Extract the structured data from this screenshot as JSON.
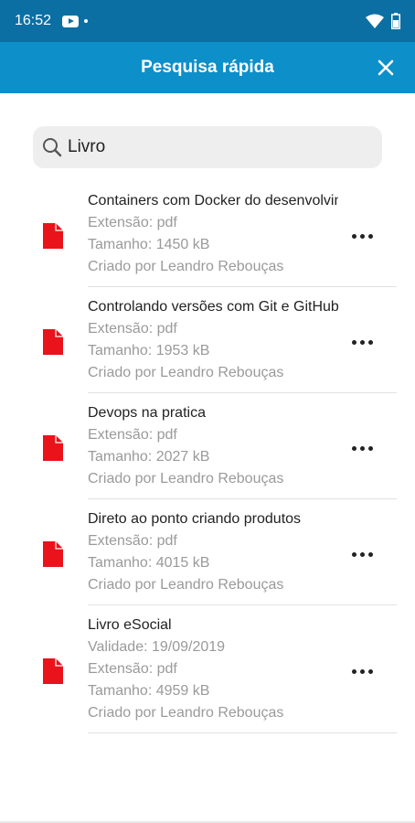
{
  "status_bar": {
    "time": "16:52"
  },
  "app_bar": {
    "title": "Pesquisa rápida"
  },
  "search": {
    "value": "Livro"
  },
  "results": [
    {
      "title": "Containers com Docker do desenvolvimento à produção",
      "lines": [
        "Extensão: pdf",
        "Tamanho: 1450 kB",
        "Criado por Leandro Rebouças"
      ]
    },
    {
      "title": "Controlando versões com Git e GitHub",
      "lines": [
        "Extensão: pdf",
        "Tamanho: 1953 kB",
        "Criado por Leandro Rebouças"
      ]
    },
    {
      "title": "Devops na pratica",
      "lines": [
        "Extensão: pdf",
        "Tamanho: 2027 kB",
        "Criado por Leandro Rebouças"
      ]
    },
    {
      "title": "Direto ao ponto criando produtos",
      "lines": [
        "Extensão: pdf",
        "Tamanho: 4015 kB",
        "Criado por Leandro Rebouças"
      ]
    },
    {
      "title": "Livro eSocial",
      "lines": [
        "Validade: 19/09/2019",
        "Extensão: pdf",
        "Tamanho: 4959 kB",
        "Criado por Leandro Rebouças"
      ]
    }
  ],
  "colors": {
    "status_bar": "#0b6fa3",
    "app_bar": "#0d8fc9",
    "pdf_icon": "#e8131b"
  },
  "icons": {
    "close": "close-icon",
    "search": "search-icon",
    "file": "pdf-file-icon",
    "more": "more-horizontal-icon"
  }
}
